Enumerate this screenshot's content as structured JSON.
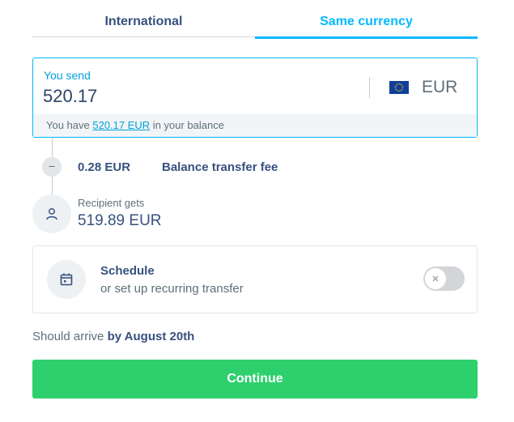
{
  "tabs": [
    {
      "label": "International",
      "active": false
    },
    {
      "label": "Same currency",
      "active": true
    }
  ],
  "send": {
    "label": "You send",
    "amount": "520.17",
    "currency": "EUR",
    "currency_icon": "eu-flag-icon",
    "balance_prefix": "You have ",
    "balance_link": "520.17 EUR",
    "balance_suffix": " in your balance"
  },
  "fee": {
    "icon": "minus-icon",
    "amount": "0.28 EUR",
    "label": "Balance transfer fee"
  },
  "recipient": {
    "icon": "person-icon",
    "label": "Recipient gets",
    "amount": "519.89 EUR"
  },
  "schedule": {
    "icon": "calendar-icon",
    "title": "Schedule",
    "subtitle": "or set up recurring transfer",
    "toggle_on": false
  },
  "arrival": {
    "prefix": "Should arrive ",
    "date": "by August 20th"
  },
  "continue_label": "Continue",
  "colors": {
    "accent": "#00b9ff",
    "continue": "#2ed06e",
    "text": "#37517e",
    "muted": "#5d7079"
  }
}
